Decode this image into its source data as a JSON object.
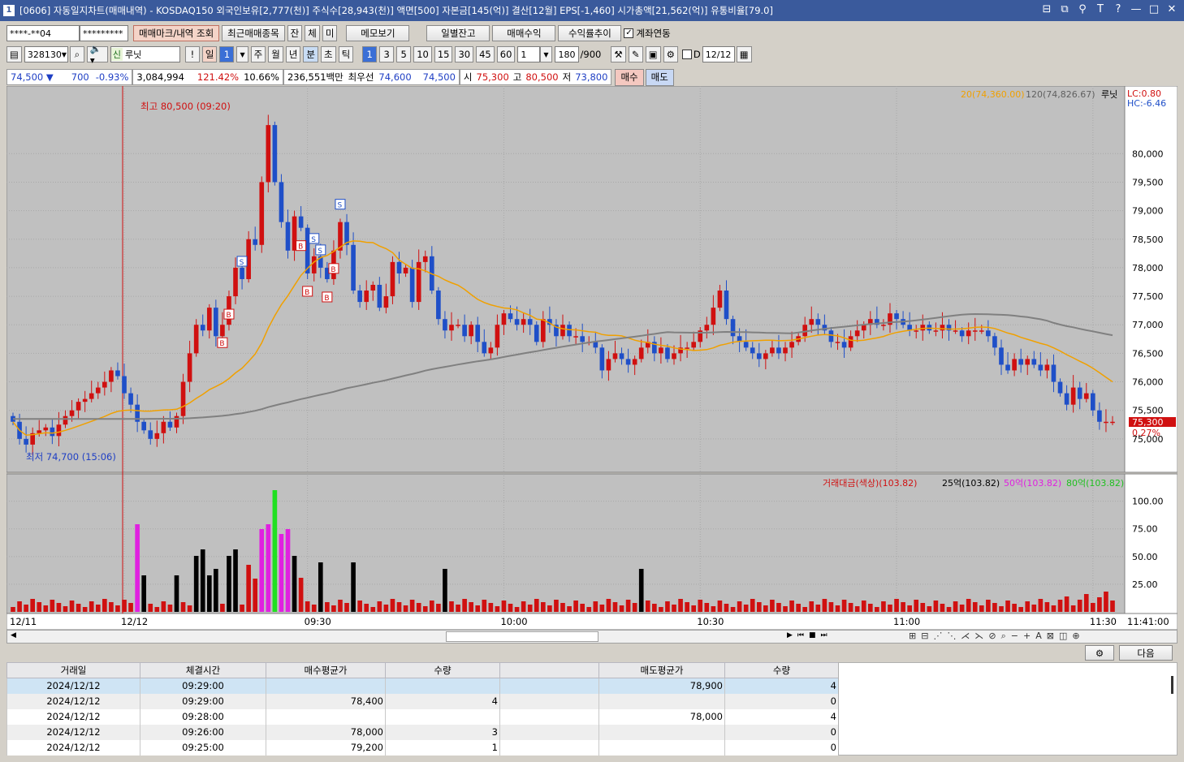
{
  "window": {
    "icon": "1",
    "title": "[0606] 자동일지차트(매매내역) - KOSDAQ150 외국인보유[2,777(천)] 주식수[28,943(천)] 액면[500] 자본금[145(억)] 결산[12월] EPS[-1,460] 시가총액[21,562(억)] 유통비율[79.0]"
  },
  "toolbar1": {
    "account": "****-**04",
    "password": "*********",
    "btn_marks": "매매마크/내역 조회",
    "btn_recent": "최근매매종목",
    "btn_jan": "잔",
    "btn_che": "체",
    "btn_mi": "미",
    "btn_memo": "메모보기",
    "btn_daily": "일별잔고",
    "btn_profit": "매매수익",
    "btn_return": "수익률추이",
    "chk_link": "계좌연동"
  },
  "toolbar2": {
    "code": "328130",
    "new_badge": "신",
    "name": "루닛",
    "excl": "!",
    "periods": [
      "일",
      "1",
      "주",
      "월",
      "년",
      "분",
      "초",
      "틱"
    ],
    "intervals": [
      "1",
      "3",
      "5",
      "10",
      "15",
      "30",
      "45",
      "60"
    ],
    "count_sel": "1",
    "bars": "180",
    "bars_total": "/900",
    "chk_d": "D",
    "date": "12/12"
  },
  "infobar": {
    "price": "74,500 ▼",
    "change": "700",
    "rate": "-0.93%",
    "volume": "3,084,994",
    "vol_ratio": "121.42%",
    "turnover": "10.66%",
    "amount": "236,551백만",
    "best_label": "최우선",
    "best_ask": "74,600",
    "best_bid": "74,500",
    "open_label": "시",
    "open": "75,300",
    "high_label": "고",
    "high": "80,500",
    "low_label": "저",
    "low": "73,800",
    "buy_btn": "매수",
    "sell_btn": "매도"
  },
  "chart_data": {
    "type": "candlestick",
    "legend": {
      "ma20": "20(74,360.00)",
      "ma120": "120(74,826.67)",
      "name": "루닛",
      "lc": "LC:0.80",
      "hc": "HC:-6.46"
    },
    "y_ticks": [
      "80,000",
      "79,500",
      "79,000",
      "78,500",
      "78,000",
      "77,500",
      "77,000",
      "76,500",
      "76,000",
      "75,500",
      "75,000"
    ],
    "ylim": [
      74500,
      80900
    ],
    "current_price": "75,300",
    "current_rate": "0.27%",
    "annotation_high": "최고 80,500 (09:20)",
    "annotation_low": "최저 74,700 (15:06)",
    "x_labels": [
      "12/11",
      "12/12",
      "09:30",
      "10:00",
      "10:30",
      "11:00",
      "11:30",
      "11:41:00"
    ],
    "closes": [
      75300,
      75000,
      74900,
      75100,
      75150,
      75200,
      75050,
      75250,
      75400,
      75500,
      75650,
      75700,
      75800,
      75900,
      76000,
      76200,
      76100,
      75800,
      75600,
      75300,
      75150,
      75000,
      75100,
      75300,
      75200,
      75400,
      76000,
      76500,
      77000,
      76900,
      77300,
      76800,
      77000,
      77500,
      78000,
      77800,
      78500,
      78400,
      79500,
      80500,
      79500,
      78800,
      78300,
      78900,
      78700,
      77900,
      78200,
      78000,
      77800,
      78300,
      78800,
      78400,
      77600,
      77400,
      77600,
      77700,
      77300,
      77500,
      78100,
      77900,
      78000,
      77400,
      78100,
      78200,
      77600,
      77100,
      76900,
      77000,
      77000,
      76800,
      77000,
      76700,
      76500,
      76600,
      77000,
      77200,
      77100,
      77000,
      77100,
      77000,
      76700,
      77100,
      77000,
      76800,
      77000,
      76800,
      76800,
      76700,
      76700,
      76600,
      76200,
      76400,
      76500,
      76400,
      76300,
      76400,
      76600,
      76700,
      76500,
      76600,
      76400,
      76500,
      76600,
      76600,
      76700,
      76900,
      77000,
      77300,
      77600,
      77100,
      76800,
      76700,
      76600,
      76500,
      76400,
      76500,
      76600,
      76500,
      76600,
      76700,
      76800,
      77000,
      77100,
      77000,
      76900,
      76700,
      76700,
      76600,
      76800,
      76900,
      77000,
      77100,
      77000,
      77000,
      77200,
      77100,
      77000,
      76900,
      76900,
      77000,
      76900,
      76900,
      77000,
      76900,
      76900,
      76800,
      76900,
      76900,
      76900,
      76800,
      76600,
      76300,
      76200,
      76400,
      76300,
      76400,
      76300,
      76200,
      76300,
      76000,
      75800,
      75600,
      75900,
      75700,
      75800,
      75500,
      75300,
      75300,
      75300
    ],
    "volume_legend": {
      "label": "거래대금(색상)(103.82)",
      "a": "25억(103.82)",
      "b": "50억(103.82)",
      "c": "80억(103.82)"
    },
    "volume_ticks": [
      "100.00",
      "75.00",
      "50.00",
      "25.00"
    ],
    "buy_marks": [
      32,
      33,
      44,
      45,
      48,
      49
    ],
    "sell_marks": [
      35,
      46,
      47,
      50
    ]
  },
  "table": {
    "headers": [
      "거래일",
      "체결시간",
      "매수평균가",
      "수량",
      "",
      "매도평균가",
      "수량"
    ],
    "rows": [
      [
        "2024/12/12",
        "09:29:00",
        "",
        "",
        "",
        "78,900",
        "4"
      ],
      [
        "2024/12/12",
        "09:29:00",
        "78,400",
        "4",
        "",
        "",
        "0"
      ],
      [
        "2024/12/12",
        "09:28:00",
        "",
        "",
        "",
        "78,000",
        "4"
      ],
      [
        "2024/12/12",
        "09:26:00",
        "78,000",
        "3",
        "",
        "",
        "0"
      ],
      [
        "2024/12/12",
        "09:25:00",
        "79,200",
        "1",
        "",
        "",
        "0"
      ]
    ],
    "next_btn": "다음"
  },
  "colors": {
    "up": "#d01010",
    "down": "#1f4fc8",
    "ma20": "#f0a000",
    "ma120": "#808080",
    "bg": "#c0c0c0"
  }
}
